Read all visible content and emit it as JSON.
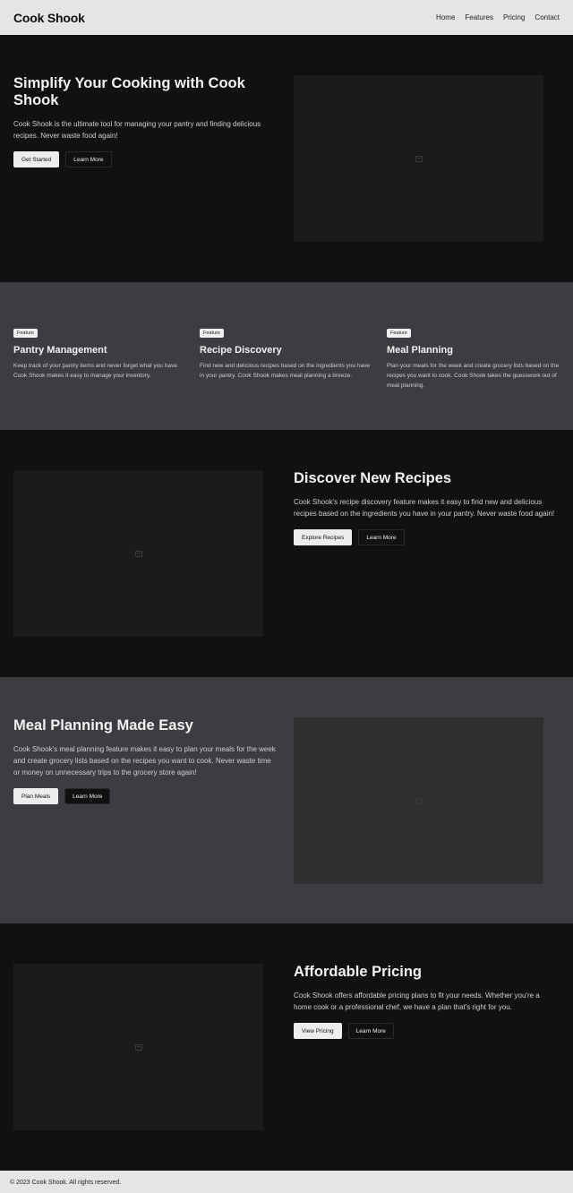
{
  "header": {
    "brand": "Cook Shook",
    "nav": [
      "Home",
      "Features",
      "Pricing",
      "Contact"
    ]
  },
  "hero": {
    "title": "Simplify Your Cooking with Cook Shook",
    "body": "Cook Shook is the ultimate tool for managing your pantry and finding delicious recipes. Never waste food again!",
    "primary_label": "Get Started",
    "secondary_label": "Learn More"
  },
  "features": {
    "badge": "Feature",
    "items": [
      {
        "title": "Pantry Management",
        "body": "Keep track of your pantry items and never forget what you have. Cook Shook makes it easy to manage your inventory."
      },
      {
        "title": "Recipe Discovery",
        "body": "Find new and delicious recipes based on the ingredients you have in your pantry. Cook Shook makes meal planning a breeze."
      },
      {
        "title": "Meal Planning",
        "body": "Plan your meals for the week and create grocery lists based on the recipes you want to cook. Cook Shook takes the guesswork out of meal planning."
      }
    ]
  },
  "discover": {
    "title": "Discover New Recipes",
    "body": "Cook Shook's recipe discovery feature makes it easy to find new and delicious recipes based on the ingredients you have in your pantry. Never waste food again!",
    "primary_label": "Explore Recipes",
    "secondary_label": "Learn More"
  },
  "meal": {
    "title": "Meal Planning Made Easy",
    "body": "Cook Shook's meal planning feature makes it easy to plan your meals for the week and create grocery lists based on the recipes you want to cook. Never waste time or money on unnecessary trips to the grocery store again!",
    "primary_label": "Plan Meals",
    "secondary_label": "Learn More"
  },
  "pricing": {
    "title": "Affordable Pricing",
    "body": "Cook Shook offers affordable pricing plans to fit your needs. Whether you're a home cook or a professional chef, we have a plan that's right for you.",
    "primary_label": "View Pricing",
    "secondary_label": "Learn More"
  },
  "footer": {
    "text": "© 2023 Cook Shook. All rights reserved."
  },
  "icons": {
    "image_placeholder": "image-icon"
  },
  "colors": {
    "header_bg": "#e5e5e5",
    "dark_bg": "#111111",
    "gray_bg": "#3d3c41"
  }
}
